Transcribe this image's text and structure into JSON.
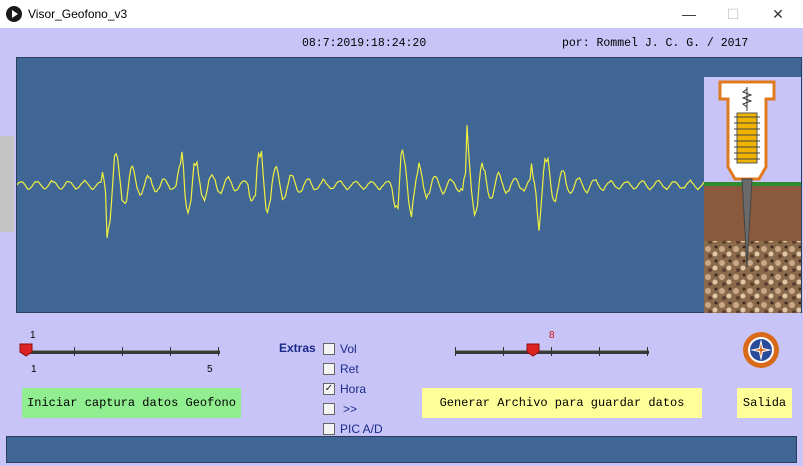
{
  "window": {
    "title": "Visor_Geofono_v3",
    "minimize_symbol": "—",
    "maximize_symbol": "☐",
    "close_symbol": "✕"
  },
  "header": {
    "datetime": "08:7:2019:18:24:20",
    "author": "por: Rommel J. C. G. / 2017"
  },
  "slider_left": {
    "value": 1,
    "value_label": "1",
    "min_label": "1",
    "max_label": "5",
    "min": 1,
    "max": 5
  },
  "slider_right": {
    "value": 8,
    "value_label": "8",
    "min": 0,
    "max": 20
  },
  "buttons": {
    "start_capture": "Iniciar captura datos Geofono",
    "generate_file": "Generar Archivo para guardar datos",
    "exit": "Salida"
  },
  "extras": {
    "label": "Extras",
    "options": [
      {
        "label": "Vol",
        "checked": false
      },
      {
        "label": "Ret",
        "checked": false
      },
      {
        "label": "Hora",
        "checked": true
      },
      {
        "label": ">>",
        "checked": false
      },
      {
        "label": "PIC A/D",
        "checked": false
      }
    ]
  },
  "colors": {
    "background": "#c8c4f8",
    "panel": "#3f6695",
    "waveform": "#f0f040",
    "start_button": "#90ee90",
    "generate_button": "#ffff99",
    "exit_button": "#ffff99",
    "slider_thumb": "#dd2222",
    "extras_text": "#1a2a8a"
  },
  "icons": {
    "app": "play-circle-icon",
    "logo": "compass-rose-emblem-icon",
    "geophone": "geophone-sensor-illustration"
  }
}
